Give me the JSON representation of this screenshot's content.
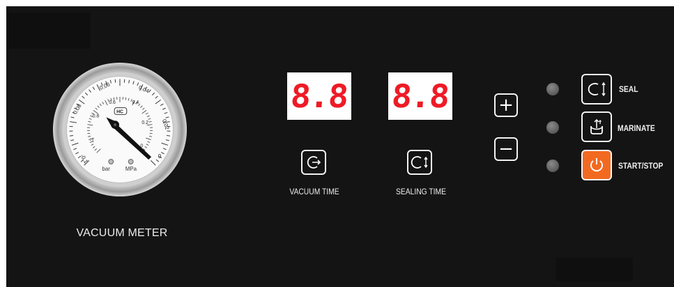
{
  "gauge": {
    "label": "VACUUM METER",
    "outer_scale": [
      "-0.1",
      "0.08",
      "0.06",
      "0.04",
      "0.02",
      "0"
    ],
    "inner_scale": [
      "-1",
      "0.8",
      "0.6",
      "0.4",
      "0.2",
      "0"
    ],
    "badge": "HC",
    "unit_left": "bar",
    "unit_right": "MPa"
  },
  "displays": {
    "vacuum_digits": "8.8",
    "sealing_digits": "8.8",
    "vacuum_label": "VACUUM TIME",
    "sealing_label": "SEALING TIME"
  },
  "controls": {
    "plus": "+",
    "minus": "−",
    "seal_label": "SEAL",
    "marinate_label": "MARINATE",
    "start_label": "START/STOP"
  },
  "colors": {
    "panel": "#141414",
    "digit_red": "#ee1b26",
    "start_orange": "#f26a21",
    "led_grey": "#6e6e6e"
  },
  "icons": [
    "vacuum-icon",
    "seal-icon",
    "marinate-icon",
    "power-icon"
  ]
}
